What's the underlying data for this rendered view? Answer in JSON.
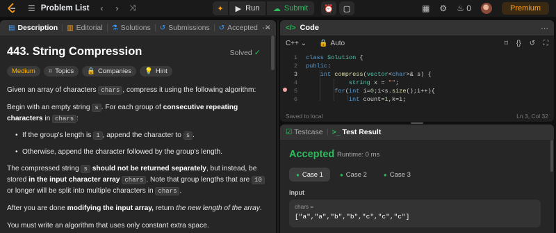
{
  "topbar": {
    "title": "Problem List",
    "run_label": "Run",
    "submit_label": "Submit",
    "notifications_count": "0",
    "premium_label": "Premium"
  },
  "left_tabs": [
    {
      "label": "Description",
      "icon": "description-icon"
    },
    {
      "label": "Editorial",
      "icon": "book-icon"
    },
    {
      "label": "Solutions",
      "icon": "flask-icon"
    },
    {
      "label": "Submissions",
      "icon": "history-icon"
    },
    {
      "label": "Accepted",
      "icon": "history-icon"
    }
  ],
  "problem": {
    "title": "443. String Compression",
    "status": "Solved",
    "difficulty": "Medium",
    "chips": [
      "Topics",
      "Companies",
      "Hint"
    ],
    "p1_a": "Given an array of characters ",
    "p1_code": "chars",
    "p1_b": ", compress it using the following algorithm:",
    "p2_a": "Begin with an empty string ",
    "p2_code": "s",
    "p2_b": ". For each group of ",
    "p2_bold": "consecutive repeating characters",
    "p2_c": " in ",
    "p2_code2": "chars",
    "p2_d": ":",
    "b1_a": "If the group's length is ",
    "b1_code": "1",
    "b1_b": ", append the character to ",
    "b1_code2": "s",
    "b1_c": ".",
    "b2": "Otherwise, append the character followed by the group's length.",
    "p3_a": "The compressed string ",
    "p3_code": "s",
    "p3_bold1": "should not be returned separately",
    "p3_b": ", but instead, be stored ",
    "p3_bold2": "in the input character array",
    "p3_code2": "chars",
    "p3_c": ". Note that group lengths that are ",
    "p3_code3": "10",
    "p3_d": " or longer will be split into multiple characters in ",
    "p3_code4": "chars",
    "p3_e": ".",
    "p4_a": "After you are done ",
    "p4_bold": "modifying the input array,",
    "p4_b": " return ",
    "p4_italic": "the new length of the array",
    "p4_c": ".",
    "p5": "You must write an algorithm that uses only constant extra space."
  },
  "code_panel": {
    "title": "Code",
    "language": "C++",
    "mode": "Auto",
    "saved": "Saved to local",
    "cursor": "Ln 3, Col 32",
    "line_numbers": [
      "1",
      "2",
      "3",
      "4",
      "5",
      "6"
    ]
  },
  "result_panel": {
    "tab1": "Testcase",
    "tab2": "Test Result",
    "verdict": "Accepted",
    "runtime": "Runtime: 0 ms",
    "cases": [
      "Case 1",
      "Case 2",
      "Case 3"
    ],
    "input_label": "Input",
    "input_key": "chars =",
    "input_value": "[\"a\",\"a\",\"b\",\"b\",\"c\",\"c\",\"c\"]"
  }
}
